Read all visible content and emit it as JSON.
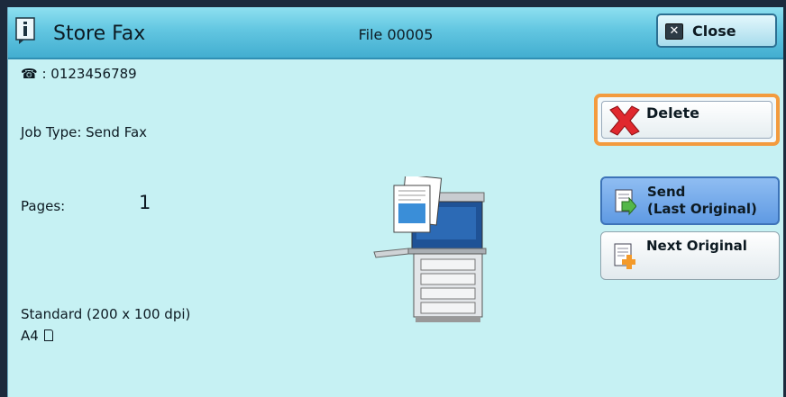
{
  "header": {
    "title": "Store Fax",
    "file": "File 00005",
    "close_label": "Close"
  },
  "details": {
    "phone": "☎ : 0123456789",
    "job_type": "Job Type: Send Fax",
    "pages_label": "Pages:",
    "pages_value": "1",
    "resolution": "Standard (200 x 100 dpi)",
    "paper": "A4"
  },
  "actions": {
    "delete_label": "Delete",
    "send_line1": "Send",
    "send_line2": "(Last Original)",
    "next_label": "Next Original"
  },
  "colors": {
    "panel": "#c6f1f3",
    "titlebar": "#62c6e1",
    "delete_highlight": "#f39b3e",
    "send_button": "#6fa6e8"
  },
  "icons": [
    "info-icon",
    "close-icon",
    "phone-icon",
    "delete-icon",
    "send-icon",
    "next-original-icon",
    "portrait-paper-icon",
    "multifunction-printer-icon"
  ]
}
